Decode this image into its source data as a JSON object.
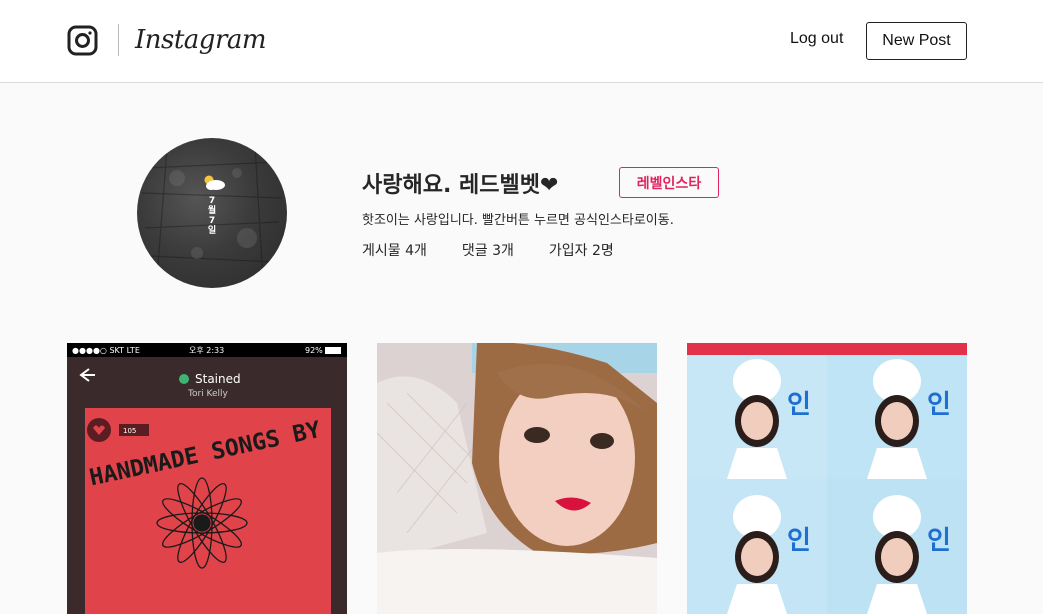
{
  "header": {
    "app_name": "Instagram",
    "logout_label": "Log out",
    "new_post_label": "New Post"
  },
  "profile": {
    "name": "사랑해요. 레드벨벳",
    "name_suffix": "❤",
    "badge_label": "레벨인스타",
    "bio": "핫조이는 사랑입니다. 빨간버튼 누르면 공식인스타로이동.",
    "avatar_lines": [
      "7",
      "월",
      "7",
      "일"
    ],
    "stats": {
      "posts": "게시물 4개",
      "comments": "댓글 3개",
      "members": "가입자 2명"
    }
  },
  "posts": [
    {
      "status_carrier": "●●●●○ SKT  LTE",
      "status_time": "오후 2:33",
      "status_battery": "92%",
      "song_title": "Stained",
      "song_artist": "Tori Kelly",
      "count": "105",
      "album_text": "HANDMADE SONGS BY"
    },
    {},
    {}
  ],
  "colors": {
    "accent": "#e0245e",
    "background": "#fafafa",
    "header_bg": "#ffffff",
    "border": "#dbdbdb"
  },
  "icons": {
    "brand": "camera-glyph-icon",
    "weather": "sun-cloud-icon",
    "back": "arrow-left-icon",
    "heart": "heart-icon"
  }
}
